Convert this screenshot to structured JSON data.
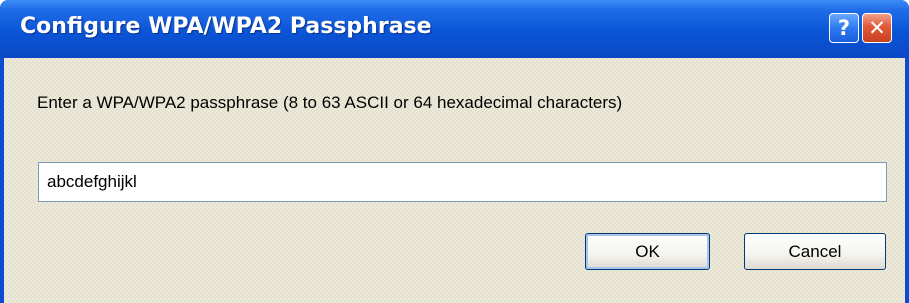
{
  "window": {
    "title": "Configure WPA/WPA2 Passphrase",
    "help_label": "?",
    "close_label": "✕"
  },
  "form": {
    "prompt": "Enter a WPA/WPA2 passphrase (8 to 63 ASCII or 64 hexadecimal characters)",
    "passphrase_value": "abcdefghijkl"
  },
  "buttons": {
    "ok_label": "OK",
    "cancel_label": "Cancel"
  },
  "colors": {
    "titlebar": "#0a55d6",
    "client_bg": "#ece9d8",
    "close_button": "#e0593a",
    "button_border": "#003c74"
  }
}
